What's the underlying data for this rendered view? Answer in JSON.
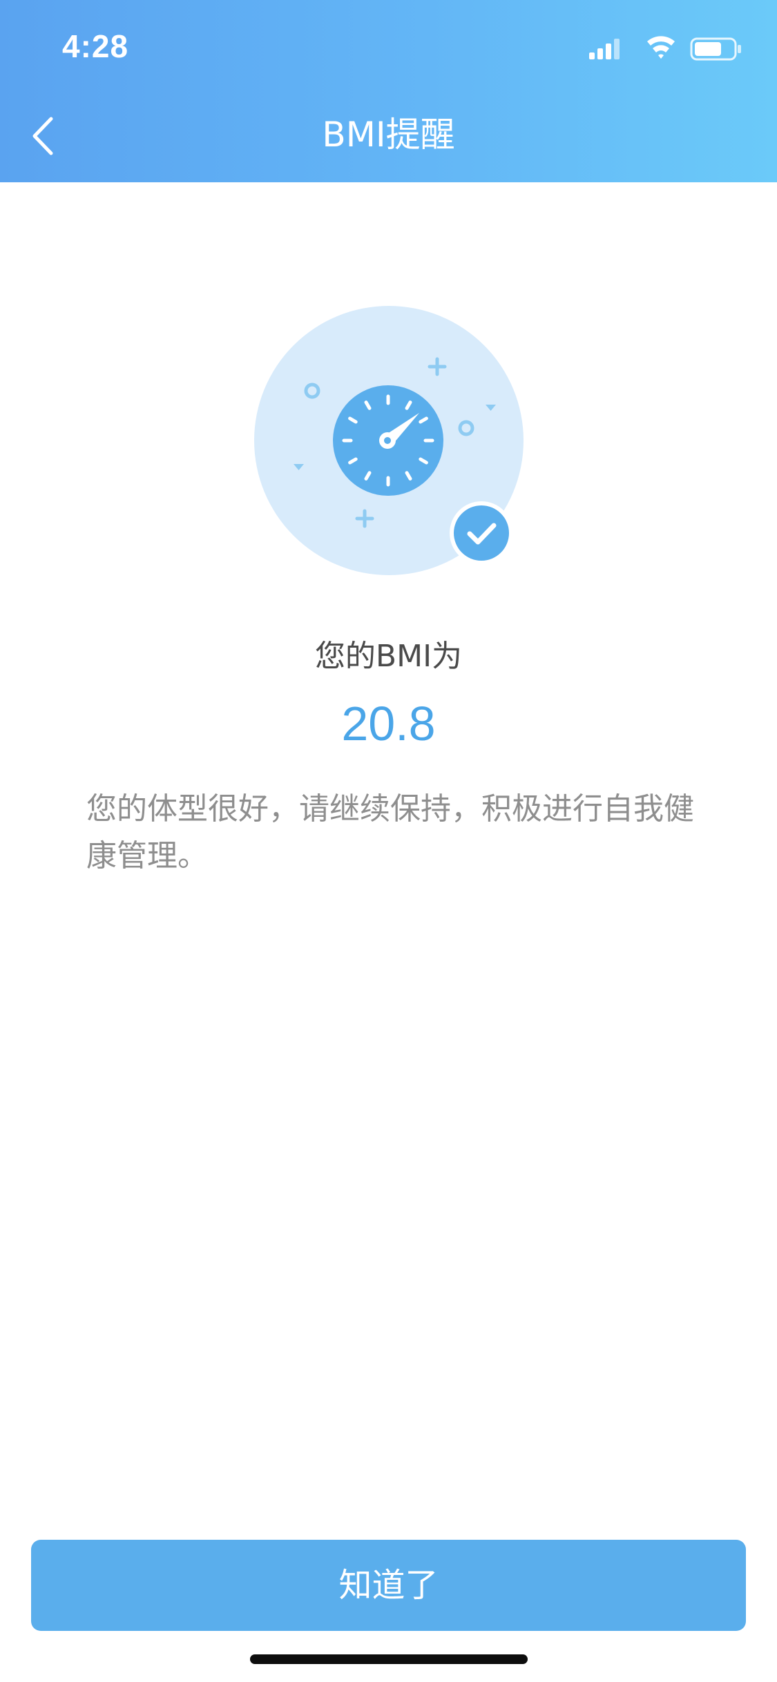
{
  "status_bar": {
    "time": "4:28",
    "icons": [
      "cellular-signal-icon",
      "wifi-icon",
      "battery-icon"
    ]
  },
  "nav": {
    "back_icon": "chevron-left-icon",
    "title": "BMI提醒"
  },
  "illustration": {
    "icon": "gauge-icon",
    "badge_icon": "check-circle-icon"
  },
  "result": {
    "label": "您的BMI为",
    "value": "20.8",
    "advice": "您的体型很好，请继续保持，积极进行自我健康管理。"
  },
  "footer": {
    "button_label": "知道了"
  },
  "colors": {
    "header_gradient_start": "#5aa3f0",
    "header_gradient_end": "#6bcaf9",
    "accent": "#4aa5e8",
    "button": "#5aaeec",
    "illustration_bg": "#d8ebfb"
  }
}
